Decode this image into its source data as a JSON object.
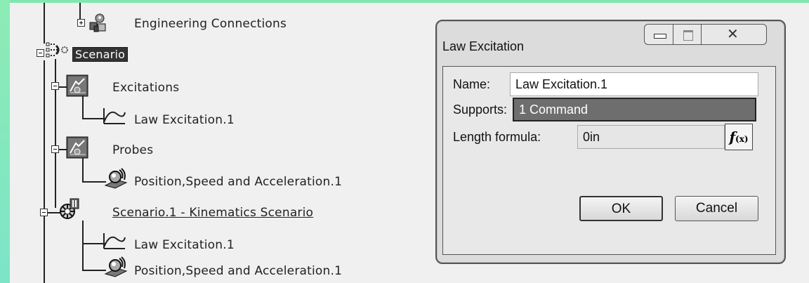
{
  "tree": {
    "engineering_connections": "Engineering Connections",
    "scenario": "Scenario",
    "excitations": "Excitations",
    "law_excitation_1": "Law Excitation.1",
    "probes": "Probes",
    "position_speed_1": "Position,Speed and Acceleration.1",
    "scenario_1": "Scenario.1 - Kinematics Scenario",
    "law_excitation_2": "Law Excitation.1",
    "position_speed_2": "Position,Speed and Acceleration.1"
  },
  "dialog": {
    "title": "Law Excitation",
    "name_label": "Name:",
    "name_value": "Law Excitation.1",
    "supports_label": "Supports:",
    "supports_value": "1 Command",
    "length_label": "Length formula:",
    "length_value": "0in",
    "fx_label": "f(x)",
    "ok_label": "OK",
    "cancel_label": "Cancel"
  },
  "colors": {
    "frame": "#7fe8b0",
    "background": "#f0f0f0",
    "selected": "#333333"
  }
}
